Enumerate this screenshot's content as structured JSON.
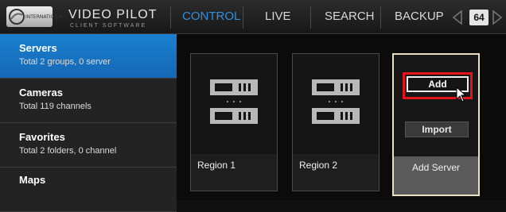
{
  "header": {
    "logo_text": "INTERNATIONAL",
    "brand": "VIDEO PILOT",
    "brand_sub": "CLIENT SOFTWARE",
    "tabs": [
      {
        "label": "CONTROL",
        "active": true
      },
      {
        "label": "LIVE",
        "active": false
      },
      {
        "label": "SEARCH",
        "active": false
      },
      {
        "label": "BACKUP",
        "active": false
      }
    ],
    "page_count": "64",
    "accent_color": "#2f8fe0"
  },
  "sidebar": {
    "items": [
      {
        "title": "Servers",
        "subtitle": "Total 2 groups, 0 server",
        "active": true
      },
      {
        "title": "Cameras",
        "subtitle": "Total 119 channels",
        "active": false
      },
      {
        "title": "Favorites",
        "subtitle": "Total 2 folders, 0 channel",
        "active": false
      },
      {
        "title": "Maps",
        "subtitle": "",
        "active": false
      }
    ]
  },
  "main": {
    "cards": [
      {
        "label": "Region 1",
        "icon": "server-rack-icon"
      },
      {
        "label": "Region 2",
        "icon": "server-rack-icon"
      }
    ],
    "add_card": {
      "label": "Add Server",
      "add_button": "Add",
      "import_button": "Import",
      "highlight_color": "#e3141b"
    }
  }
}
